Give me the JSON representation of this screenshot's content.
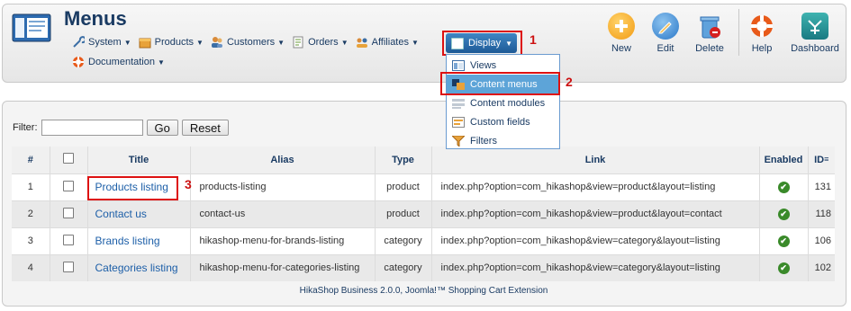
{
  "header": {
    "title": "Menus"
  },
  "menu": {
    "row1": [
      {
        "label": "System",
        "icon": "wrench-icon"
      },
      {
        "label": "Products",
        "icon": "box-icon"
      },
      {
        "label": "Customers",
        "icon": "users-icon"
      },
      {
        "label": "Orders",
        "icon": "orders-icon"
      },
      {
        "label": "Affiliates",
        "icon": "affiliates-icon"
      }
    ],
    "row2": [
      {
        "label": "Documentation",
        "icon": "lifebuoy-icon"
      }
    ],
    "display": "Display"
  },
  "display_dropdown": [
    {
      "label": "Views",
      "icon": "views-icon"
    },
    {
      "label": "Content menus",
      "icon": "content-menus-icon"
    },
    {
      "label": "Content modules",
      "icon": "content-modules-icon"
    },
    {
      "label": "Custom fields",
      "icon": "custom-fields-icon"
    },
    {
      "label": "Filters",
      "icon": "filters-icon"
    }
  ],
  "toolbar": {
    "new": "New",
    "edit": "Edit",
    "delete": "Delete",
    "help": "Help",
    "dashboard": "Dashboard"
  },
  "callouts": {
    "c1": "1",
    "c2": "2",
    "c3": "3"
  },
  "filter": {
    "label": "Filter:",
    "value": "",
    "go": "Go",
    "reset": "Reset"
  },
  "table": {
    "headers": {
      "num": "#",
      "title": "Title",
      "alias": "Alias",
      "type": "Type",
      "link": "Link",
      "enabled": "Enabled",
      "id": "ID"
    },
    "rows": [
      {
        "num": "1",
        "title": "Products listing",
        "alias": "products-listing",
        "type": "product",
        "link": "index.php?option=com_hikashop&view=product&layout=listing",
        "id": "131"
      },
      {
        "num": "2",
        "title": "Contact us",
        "alias": "contact-us",
        "type": "product",
        "link": "index.php?option=com_hikashop&view=product&layout=contact",
        "id": "118"
      },
      {
        "num": "3",
        "title": "Brands listing",
        "alias": "hikashop-menu-for-brands-listing",
        "type": "category",
        "link": "index.php?option=com_hikashop&view=category&layout=listing",
        "id": "106"
      },
      {
        "num": "4",
        "title": "Categories listing",
        "alias": "hikashop-menu-for-categories-listing",
        "type": "category",
        "link": "index.php?option=com_hikashop&view=category&layout=listing",
        "id": "102"
      }
    ]
  },
  "footer": {
    "text": "HikaShop Business 2.0.0, Joomla!™ Shopping Cart Extension"
  },
  "colors": {
    "accent": "#1a3b63",
    "highlight": "#dd1111",
    "enabled": "#3a8a2a"
  }
}
